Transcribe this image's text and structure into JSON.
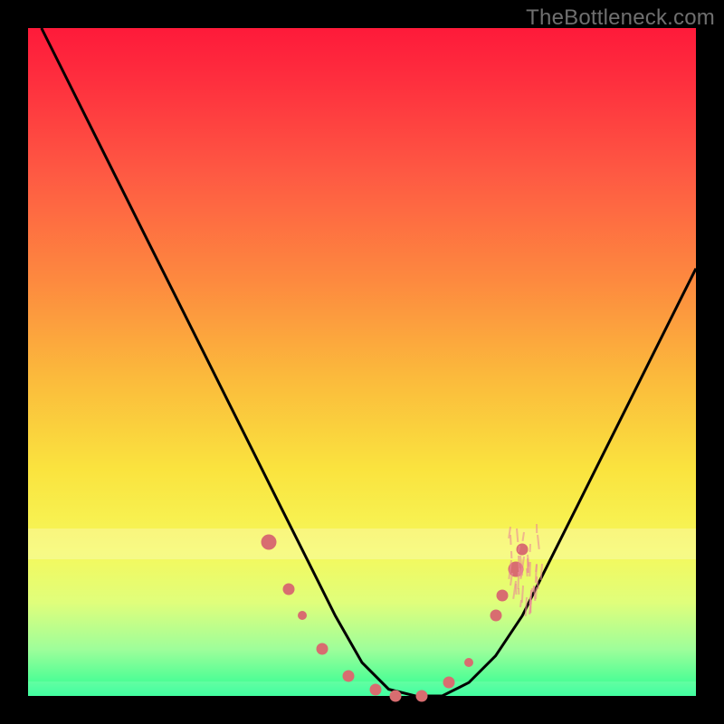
{
  "watermark": "TheBottleneck.com",
  "chart_data": {
    "type": "line",
    "title": "",
    "xlabel": "",
    "ylabel": "",
    "xlim": [
      0,
      100
    ],
    "ylim": [
      0,
      100
    ],
    "series": [
      {
        "name": "bottleneck-curve",
        "x": [
          2,
          6,
          10,
          14,
          18,
          22,
          26,
          30,
          34,
          38,
          42,
          46,
          50,
          54,
          58,
          62,
          66,
          70,
          74,
          78,
          82,
          86,
          90,
          94,
          98,
          100
        ],
        "y": [
          100,
          92,
          84,
          76,
          68,
          60,
          52,
          44,
          36,
          28,
          20,
          12,
          5,
          1,
          0,
          0,
          2,
          6,
          12,
          20,
          28,
          36,
          44,
          52,
          60,
          64
        ]
      }
    ],
    "markers": {
      "name": "highlight-points",
      "color": "#d86d70",
      "points": [
        {
          "x": 36,
          "y": 23,
          "size": "big"
        },
        {
          "x": 39,
          "y": 16,
          "size": "normal"
        },
        {
          "x": 41,
          "y": 12,
          "size": "sm"
        },
        {
          "x": 44,
          "y": 7,
          "size": "normal"
        },
        {
          "x": 48,
          "y": 3,
          "size": "normal"
        },
        {
          "x": 52,
          "y": 1,
          "size": "normal"
        },
        {
          "x": 55,
          "y": 0,
          "size": "normal"
        },
        {
          "x": 59,
          "y": 0,
          "size": "normal"
        },
        {
          "x": 63,
          "y": 2,
          "size": "normal"
        },
        {
          "x": 66,
          "y": 5,
          "size": "sm"
        },
        {
          "x": 70,
          "y": 12,
          "size": "normal"
        },
        {
          "x": 71,
          "y": 15,
          "size": "normal"
        },
        {
          "x": 73,
          "y": 19,
          "size": "big"
        },
        {
          "x": 74,
          "y": 22,
          "size": "normal"
        }
      ]
    },
    "background_gradient": {
      "top": "#fe1a3a",
      "mid1": "#fd8a3f",
      "mid2": "#fae33e",
      "bottom": "#28fe93"
    }
  }
}
